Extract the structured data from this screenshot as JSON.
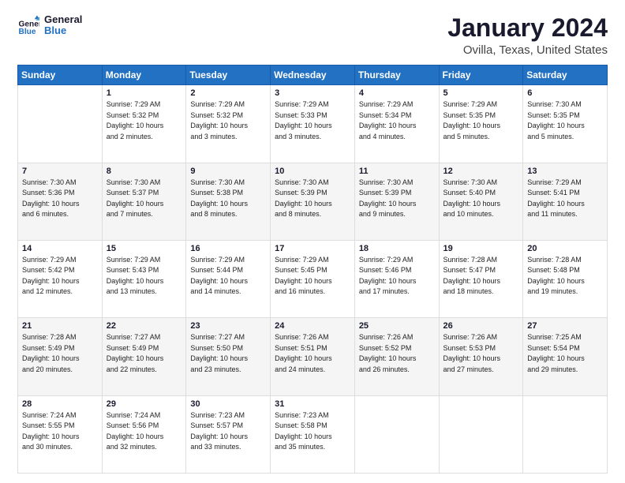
{
  "logo": {
    "line1": "General",
    "line2": "Blue"
  },
  "header": {
    "title": "January 2024",
    "subtitle": "Ovilla, Texas, United States"
  },
  "weekdays": [
    "Sunday",
    "Monday",
    "Tuesday",
    "Wednesday",
    "Thursday",
    "Friday",
    "Saturday"
  ],
  "weeks": [
    [
      {
        "day": "",
        "info": ""
      },
      {
        "day": "1",
        "info": "Sunrise: 7:29 AM\nSunset: 5:32 PM\nDaylight: 10 hours\nand 2 minutes."
      },
      {
        "day": "2",
        "info": "Sunrise: 7:29 AM\nSunset: 5:32 PM\nDaylight: 10 hours\nand 3 minutes."
      },
      {
        "day": "3",
        "info": "Sunrise: 7:29 AM\nSunset: 5:33 PM\nDaylight: 10 hours\nand 3 minutes."
      },
      {
        "day": "4",
        "info": "Sunrise: 7:29 AM\nSunset: 5:34 PM\nDaylight: 10 hours\nand 4 minutes."
      },
      {
        "day": "5",
        "info": "Sunrise: 7:29 AM\nSunset: 5:35 PM\nDaylight: 10 hours\nand 5 minutes."
      },
      {
        "day": "6",
        "info": "Sunrise: 7:30 AM\nSunset: 5:35 PM\nDaylight: 10 hours\nand 5 minutes."
      }
    ],
    [
      {
        "day": "7",
        "info": "Sunrise: 7:30 AM\nSunset: 5:36 PM\nDaylight: 10 hours\nand 6 minutes."
      },
      {
        "day": "8",
        "info": "Sunrise: 7:30 AM\nSunset: 5:37 PM\nDaylight: 10 hours\nand 7 minutes."
      },
      {
        "day": "9",
        "info": "Sunrise: 7:30 AM\nSunset: 5:38 PM\nDaylight: 10 hours\nand 8 minutes."
      },
      {
        "day": "10",
        "info": "Sunrise: 7:30 AM\nSunset: 5:39 PM\nDaylight: 10 hours\nand 8 minutes."
      },
      {
        "day": "11",
        "info": "Sunrise: 7:30 AM\nSunset: 5:39 PM\nDaylight: 10 hours\nand 9 minutes."
      },
      {
        "day": "12",
        "info": "Sunrise: 7:30 AM\nSunset: 5:40 PM\nDaylight: 10 hours\nand 10 minutes."
      },
      {
        "day": "13",
        "info": "Sunrise: 7:29 AM\nSunset: 5:41 PM\nDaylight: 10 hours\nand 11 minutes."
      }
    ],
    [
      {
        "day": "14",
        "info": "Sunrise: 7:29 AM\nSunset: 5:42 PM\nDaylight: 10 hours\nand 12 minutes."
      },
      {
        "day": "15",
        "info": "Sunrise: 7:29 AM\nSunset: 5:43 PM\nDaylight: 10 hours\nand 13 minutes."
      },
      {
        "day": "16",
        "info": "Sunrise: 7:29 AM\nSunset: 5:44 PM\nDaylight: 10 hours\nand 14 minutes."
      },
      {
        "day": "17",
        "info": "Sunrise: 7:29 AM\nSunset: 5:45 PM\nDaylight: 10 hours\nand 16 minutes."
      },
      {
        "day": "18",
        "info": "Sunrise: 7:29 AM\nSunset: 5:46 PM\nDaylight: 10 hours\nand 17 minutes."
      },
      {
        "day": "19",
        "info": "Sunrise: 7:28 AM\nSunset: 5:47 PM\nDaylight: 10 hours\nand 18 minutes."
      },
      {
        "day": "20",
        "info": "Sunrise: 7:28 AM\nSunset: 5:48 PM\nDaylight: 10 hours\nand 19 minutes."
      }
    ],
    [
      {
        "day": "21",
        "info": "Sunrise: 7:28 AM\nSunset: 5:49 PM\nDaylight: 10 hours\nand 20 minutes."
      },
      {
        "day": "22",
        "info": "Sunrise: 7:27 AM\nSunset: 5:49 PM\nDaylight: 10 hours\nand 22 minutes."
      },
      {
        "day": "23",
        "info": "Sunrise: 7:27 AM\nSunset: 5:50 PM\nDaylight: 10 hours\nand 23 minutes."
      },
      {
        "day": "24",
        "info": "Sunrise: 7:26 AM\nSunset: 5:51 PM\nDaylight: 10 hours\nand 24 minutes."
      },
      {
        "day": "25",
        "info": "Sunrise: 7:26 AM\nSunset: 5:52 PM\nDaylight: 10 hours\nand 26 minutes."
      },
      {
        "day": "26",
        "info": "Sunrise: 7:26 AM\nSunset: 5:53 PM\nDaylight: 10 hours\nand 27 minutes."
      },
      {
        "day": "27",
        "info": "Sunrise: 7:25 AM\nSunset: 5:54 PM\nDaylight: 10 hours\nand 29 minutes."
      }
    ],
    [
      {
        "day": "28",
        "info": "Sunrise: 7:24 AM\nSunset: 5:55 PM\nDaylight: 10 hours\nand 30 minutes."
      },
      {
        "day": "29",
        "info": "Sunrise: 7:24 AM\nSunset: 5:56 PM\nDaylight: 10 hours\nand 32 minutes."
      },
      {
        "day": "30",
        "info": "Sunrise: 7:23 AM\nSunset: 5:57 PM\nDaylight: 10 hours\nand 33 minutes."
      },
      {
        "day": "31",
        "info": "Sunrise: 7:23 AM\nSunset: 5:58 PM\nDaylight: 10 hours\nand 35 minutes."
      },
      {
        "day": "",
        "info": ""
      },
      {
        "day": "",
        "info": ""
      },
      {
        "day": "",
        "info": ""
      }
    ]
  ]
}
